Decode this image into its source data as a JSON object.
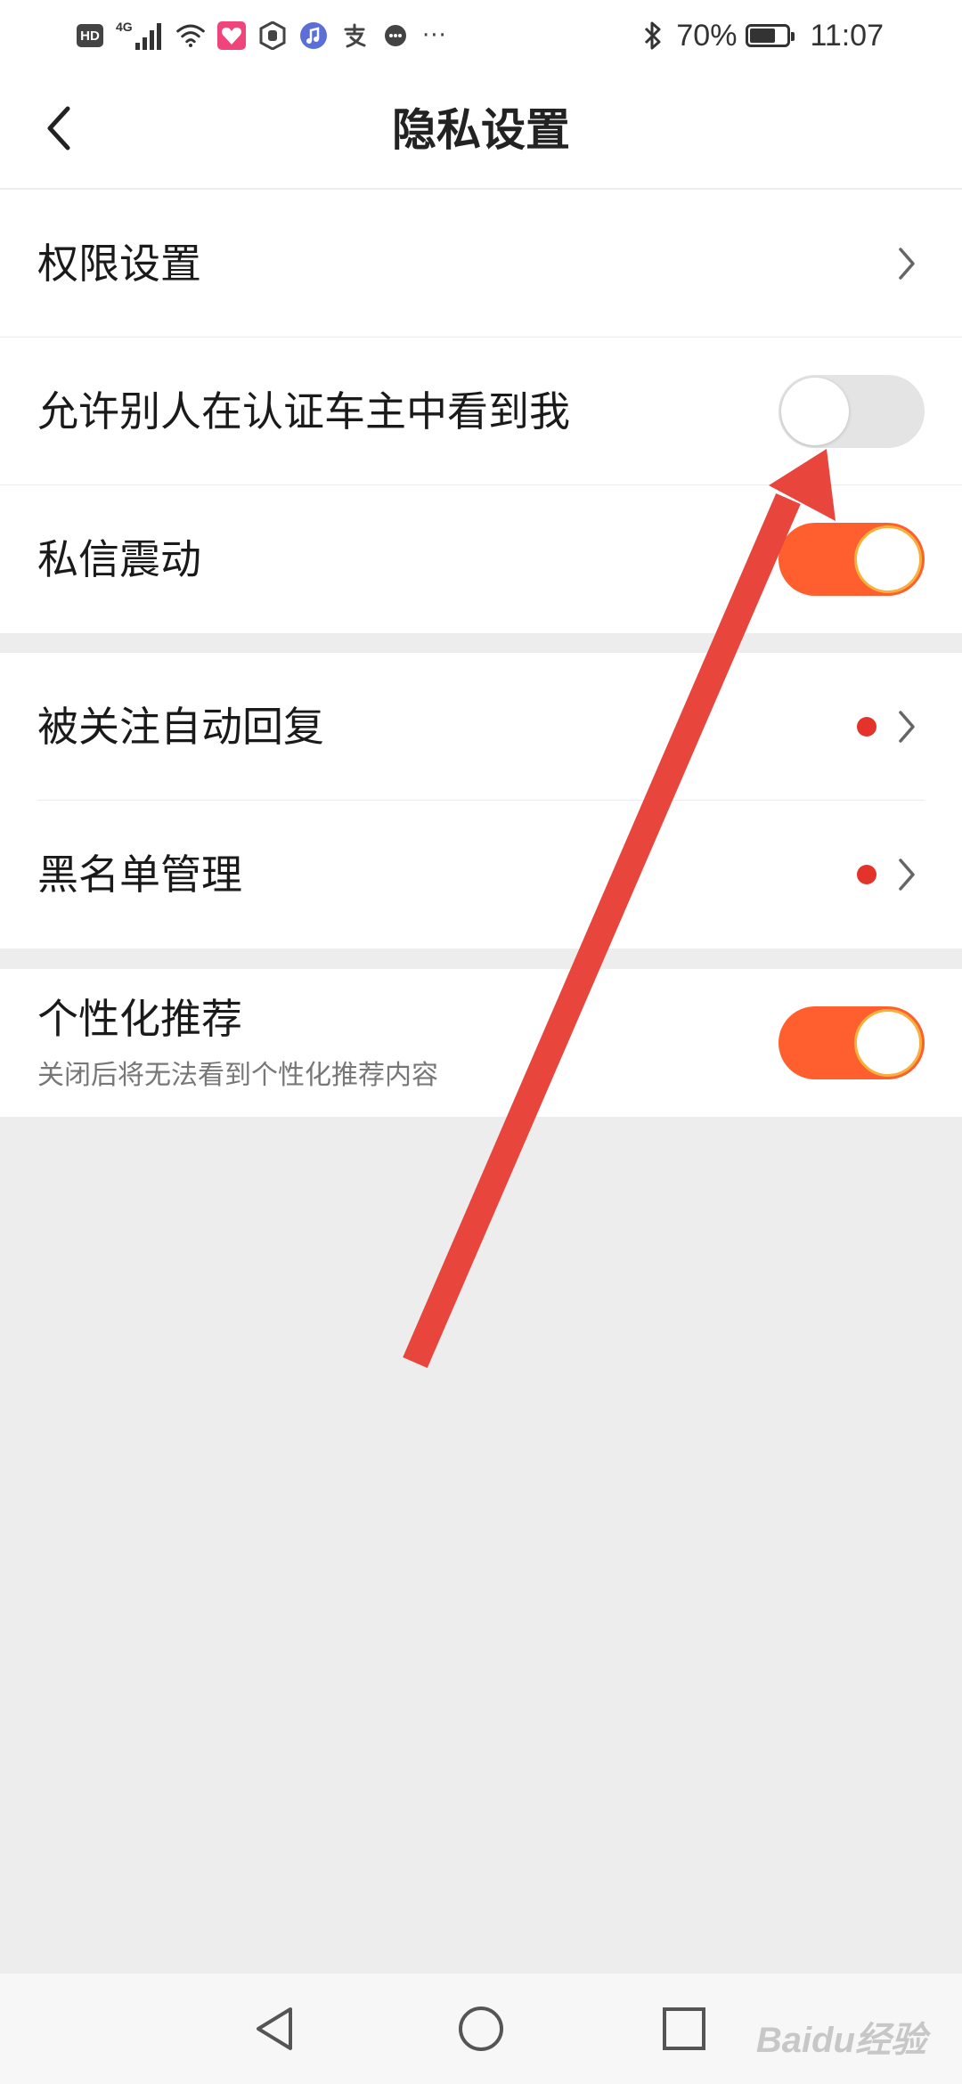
{
  "status_bar": {
    "hd_label": "HD",
    "network_label": "4G",
    "battery_percent": "70%",
    "battery_level": 0.7,
    "time": "11:07",
    "more_label": "···"
  },
  "header": {
    "title": "隐私设置",
    "back_icon": "chevron-left-icon"
  },
  "sections": [
    {
      "items": [
        {
          "label": "权限设置",
          "type": "link"
        },
        {
          "label": "允许别人在认证车主中看到我",
          "type": "toggle",
          "on": false
        },
        {
          "label": "私信震动",
          "type": "toggle",
          "on": true
        }
      ]
    },
    {
      "items": [
        {
          "label": "被关注自动回复",
          "type": "link",
          "badge_dot": true
        },
        {
          "label": "黑名单管理",
          "type": "link",
          "badge_dot": true
        }
      ]
    },
    {
      "items": [
        {
          "label": "个性化推荐",
          "sublabel": "关闭后将无法看到个性化推荐内容",
          "type": "toggle",
          "on": true
        }
      ]
    }
  ],
  "colors": {
    "toggle_on": "#ff5f2e",
    "toggle_knob_ring": "#f5b13b",
    "toggle_off": "#e4e4e4",
    "badge_dot": "#e4332b",
    "annotation_arrow": "#e8453c"
  },
  "system_nav": {
    "back_icon": "triangle-back-icon",
    "home_icon": "circle-home-icon",
    "recents_icon": "square-recents-icon"
  },
  "watermark": "Baidu经验"
}
